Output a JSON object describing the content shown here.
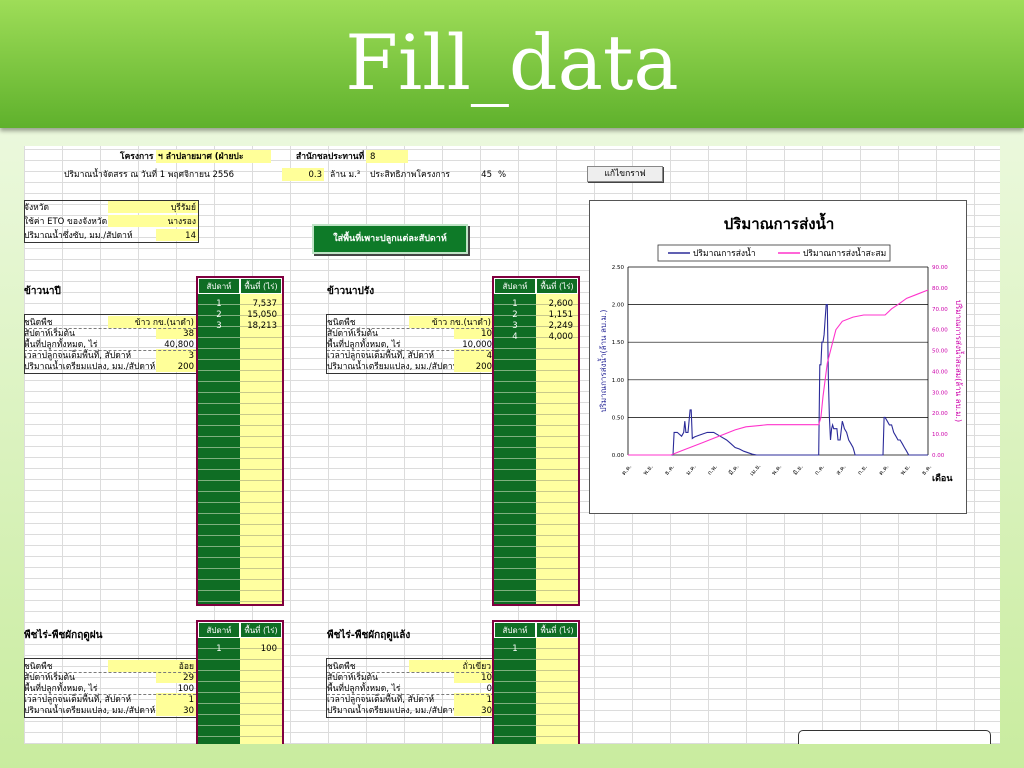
{
  "slide": {
    "title": "Fill_data"
  },
  "header": {
    "project_label": "โครงการ",
    "project_value": "ฯ ลำปลายมาศ (ฝ่ายปะ",
    "office_label": "สำนักชลประทานที่",
    "office_value": "8",
    "water_alloc_label": "ปริมาณน้ำจัดสรร ณ วันที่ 1 พฤศจิกายน 2556",
    "water_alloc_value": "0.3",
    "water_alloc_unit": "ล้าน ม.³",
    "efficiency_label": "ประสิทธิภาพโครงการ",
    "efficiency_value": "45",
    "efficiency_unit": "%"
  },
  "edit_chart_button": "แก้ไขกราฟ",
  "fill_area_button": "ใส่พื้นที่เพาะปลูกแต่ละสัปดาห์",
  "province": {
    "province_label": "จังหวัด",
    "province_value": "บุรีรัมย์",
    "eto_label": "ใช้ค่า ETO ของจังหวัด",
    "eto_value": "นางรอง",
    "rain_label": "ปริมาณน้ำซึ่งซับ, มม./สัปดาห์",
    "rain_value": "14"
  },
  "col_week": "สัปดาห์",
  "col_area": "พื้นที่ (ไร่)",
  "sections": [
    {
      "title": "ข้าวนาปี",
      "crop_label": "ชนิดพืช",
      "crop_value": "ข้าว กข.(นาดำ)",
      "start_label": "สัปดาห์เริ่มต้น",
      "start_value": "38",
      "total_label": "พื้นที่ปลูกทั้งหมด, ไร่",
      "total_value": "40,800",
      "time_label": "เวลาปลูกจนเต็มพื้นที่, สัปดาห์",
      "time_value": "3",
      "prep_label": "ปริมาณน้ำเตรียมแปลง, มม./สัปดาห์",
      "prep_value": "200",
      "weeks": [
        "1",
        "2",
        "3"
      ],
      "areas": [
        "7,537",
        "15,050",
        "18,213"
      ]
    },
    {
      "title": "ข้าวนาปรัง",
      "crop_label": "ชนิดพืช",
      "crop_value": "ข้าว กข.(นาดำ)",
      "start_label": "สัปดาห์เริ่มต้น",
      "start_value": "10",
      "total_label": "พื้นที่ปลูกทั้งหมด, ไร่",
      "total_value": "10,000",
      "time_label": "เวลาปลูกจนเต็มพื้นที่, สัปดาห์",
      "time_value": "4",
      "prep_label": "ปริมาณน้ำเตรียมแปลง, มม./สัปดาห์",
      "prep_value": "200",
      "weeks": [
        "1",
        "2",
        "3",
        "4"
      ],
      "areas": [
        "2,600",
        "1,151",
        "2,249",
        "4,000"
      ]
    },
    {
      "title": "พืชไร่-พืชผักฤดูฝน",
      "crop_label": "ชนิดพืช",
      "crop_value": "อ้อย",
      "start_label": "สัปดาห์เริ่มต้น",
      "start_value": "29",
      "total_label": "พื้นที่ปลูกทั้งหมด, ไร่",
      "total_value": "100",
      "time_label": "เวลาปลูกจนเต็มพื้นที่, สัปดาห์",
      "time_value": "1",
      "prep_label": "ปริมาณน้ำเตรียมแปลง, มม./สัปดาห์",
      "prep_value": "30",
      "weeks": [
        "1"
      ],
      "areas": [
        "100"
      ]
    },
    {
      "title": "พืชไร่-พืชผักฤดูแล้ง",
      "crop_label": "ชนิดพืช",
      "crop_value": "ถั่วเขียว",
      "start_label": "สัปดาห์เริ่มต้น",
      "start_value": "10",
      "total_label": "พื้นที่ปลูกทั้งหมด, ไร่",
      "total_value": "0",
      "time_label": "เวลาปลูกจนเต็มพื้นที่, สัปดาห์",
      "time_value": "1",
      "prep_label": "ปริมาณน้ำเตรียมแปลง, มม./สัปดาห์",
      "prep_value": "30",
      "weeks": [
        "1"
      ],
      "areas": []
    }
  ],
  "chart_data": {
    "type": "line",
    "title": "ปริมาณการส่งน้ำ",
    "ylabel": "ปริมาณการส่งน้ำ(ล้าน ลบ.ม.)",
    "y2label": "ปริมาณการส่งน้ำสะสม(ล้าน ลบ.ม.)",
    "xlabel": "เดือน",
    "ylim": [
      0,
      2.5
    ],
    "y2lim": [
      0,
      90
    ],
    "yticks": [
      "0.00",
      "0.50",
      "1.00",
      "1.50",
      "2.00",
      "2.50"
    ],
    "y2ticks": [
      "0.00",
      "10.00",
      "20.00",
      "30.00",
      "40.00",
      "50.00",
      "60.00",
      "70.00",
      "80.00",
      "90.00"
    ],
    "categories": [
      "ต.ค.",
      "พ.ย.",
      "ธ.ค.",
      "ม.ค.",
      "ก.พ.",
      "มี.ค.",
      "เม.ย.",
      "พ.ค.",
      "มิ.ย.",
      "ก.ค.",
      "ส.ค.",
      "ก.ย.",
      "ต.ค.",
      "พ.ย.",
      "ธ.ค."
    ],
    "series": [
      {
        "name": "ปริมาณการส่งน้ำ",
        "color": "#2b2b99",
        "axis": "left",
        "x": [
          0,
          1,
          1.5,
          2,
          2.1,
          2.15,
          2.3,
          2.5,
          2.6,
          2.65,
          2.7,
          2.8,
          2.9,
          2.95,
          3,
          3.1,
          3.3,
          3.5,
          3.7,
          4,
          4.3,
          4.6,
          4.8,
          5,
          5.2,
          5.4,
          5.6,
          5.8,
          6,
          6.1,
          8.9,
          8.95,
          9.0,
          9.05,
          9.1,
          9.15,
          9.2,
          9.25,
          9.3,
          9.35,
          9.4,
          9.45,
          9.5,
          9.55,
          9.6,
          9.65,
          9.7,
          9.75,
          9.8,
          9.9,
          10,
          10.05,
          10.1,
          10.2,
          10.3,
          10.4,
          10.5,
          10.55,
          10.6,
          11.9,
          11.95,
          12,
          12.1,
          12.2,
          12.3,
          12.4,
          12.5,
          12.6,
          12.7,
          12.8,
          12.9,
          13,
          13.1,
          13.2,
          13.3,
          13.4,
          13.5,
          13.6,
          13.7,
          13.8,
          13.9,
          14
        ],
        "y": [
          0,
          0,
          0,
          0,
          0,
          0.3,
          0.3,
          0.25,
          0.3,
          0.45,
          0.3,
          0.3,
          0.6,
          0.6,
          0.22,
          0.24,
          0.26,
          0.28,
          0.3,
          0.3,
          0.25,
          0.2,
          0.15,
          0.1,
          0.08,
          0.05,
          0.03,
          0.01,
          0,
          0,
          0,
          1.2,
          1.2,
          1.5,
          1.5,
          1.6,
          1.8,
          2.0,
          2.0,
          1.0,
          0.5,
          0.2,
          0.35,
          0.4,
          0.35,
          0.35,
          0.35,
          0.35,
          0.2,
          0.2,
          0.45,
          0.4,
          0.35,
          0.3,
          0.2,
          0.15,
          0.1,
          0.05,
          0,
          0,
          0.5,
          0.5,
          0.45,
          0.4,
          0.4,
          0.3,
          0.25,
          0.2,
          0.2,
          0.15,
          0.1,
          0.05,
          0,
          0,
          0,
          0,
          0,
          0,
          0,
          0,
          0,
          0
        ]
      },
      {
        "name": "ปริมาณการส่งน้ำสะสม",
        "color": "#ff33cc",
        "axis": "right",
        "x": [
          0,
          1,
          1.5,
          2,
          2.5,
          3,
          3.5,
          4,
          4.5,
          5,
          5.5,
          6,
          6.5,
          7,
          7.5,
          8,
          8.5,
          8.9,
          9,
          9.1,
          9.3,
          9.5,
          9.7,
          10,
          10.5,
          11,
          11.5,
          12,
          12.3,
          12.6,
          13,
          13.5,
          14
        ],
        "y": [
          0,
          0,
          0,
          0,
          2,
          4,
          6,
          8,
          10,
          12,
          13.5,
          14,
          14.5,
          14.5,
          14.5,
          14.5,
          14.5,
          14.5,
          18,
          28,
          44,
          52,
          60,
          64,
          66,
          67,
          67,
          67,
          70,
          72,
          75,
          77,
          79
        ]
      }
    ]
  }
}
